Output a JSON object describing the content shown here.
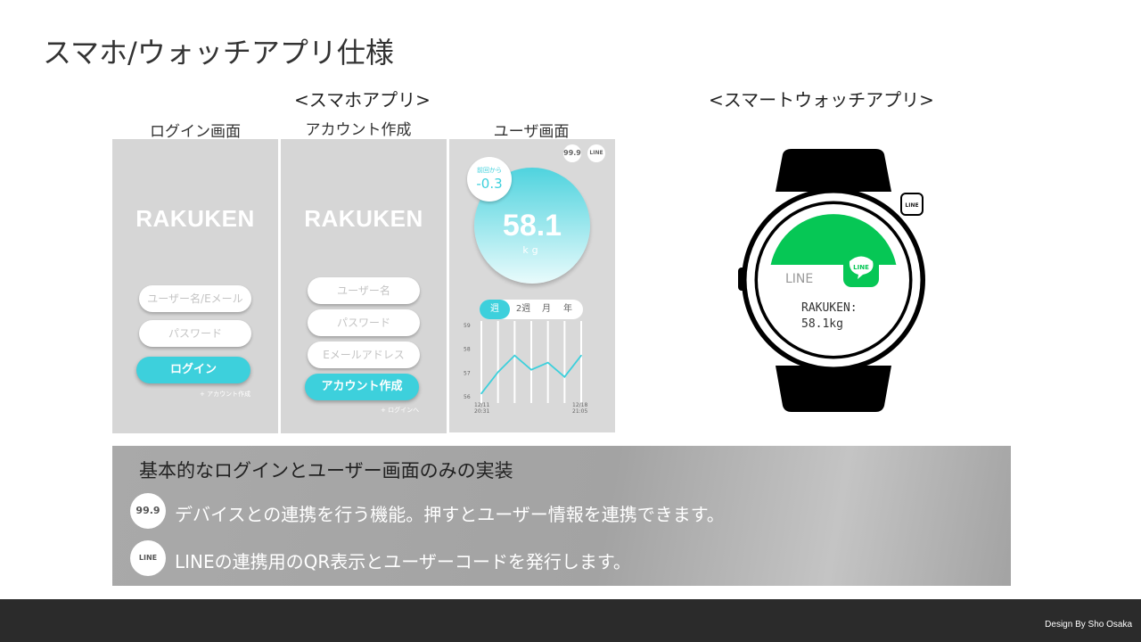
{
  "page": {
    "title": "スマホ/ウォッチアプリ仕様",
    "phone_section": "<スマホアプリ>",
    "watch_section": "<スマートウォッチアプリ>"
  },
  "screens": {
    "login": {
      "label": "ログイン画面",
      "logo": "RAKUKEN",
      "username_placeholder": "ユーザー名/Eメール",
      "password_placeholder": "パスワード",
      "login_button": "ログイン",
      "create_link": "+ アカウント作成"
    },
    "signup": {
      "label": "アカウント作成",
      "logo": "RAKUKEN",
      "username_placeholder": "ユーザー名",
      "password_placeholder": "パスワード",
      "email_placeholder": "Eメールアドレス",
      "create_button": "アカウント作成",
      "login_link": "+ ログインへ"
    },
    "user": {
      "label": "ユーザ画面",
      "device_icon_text": "99.9",
      "line_icon_text": "LINE",
      "badge_caption": "前回から",
      "badge_value": "-0.3",
      "weight": "58.1",
      "unit": "kg",
      "tabs": [
        "週",
        "2週",
        "月",
        "年"
      ],
      "active_tab": 0
    }
  },
  "chart_data": {
    "type": "line",
    "x": [
      "12/11 20:31",
      "",
      "",
      "",
      "",
      "",
      "12/18 21:05"
    ],
    "x_start_label": "12/11\n20:31",
    "x_end_label": "12/18\n21:05",
    "ylim": [
      56,
      59
    ],
    "yticks": [
      "59",
      "58",
      "57",
      "56"
    ],
    "series": [
      {
        "values": [
          56.1,
          57.0,
          57.7,
          57.1,
          57.4,
          56.8,
          57.7
        ]
      }
    ],
    "line_color": "#3dd0dc",
    "grid": true
  },
  "watch": {
    "app_name": "LINE",
    "app_icon_text": "LINE",
    "side_icon_text": "LINE",
    "message_line1": "RAKUKEN:",
    "message_line2": "58.1kg"
  },
  "info": {
    "title": "基本的なログインとユーザー画面のみの実装",
    "rows": [
      {
        "icon": "99.9",
        "text": "デバイスとの連携を行う機能。押すとユーザー情報を連携できます。"
      },
      {
        "icon": "LINE",
        "text": "LINEの連携用のQR表示とユーザーコードを発行します。"
      }
    ]
  },
  "footer": {
    "credit": "Design By Sho Osaka"
  },
  "colors": {
    "accent": "#3dd0dc",
    "line_green": "#06c755",
    "panel": "#d6d6d6",
    "footer": "#2b2b2b"
  }
}
